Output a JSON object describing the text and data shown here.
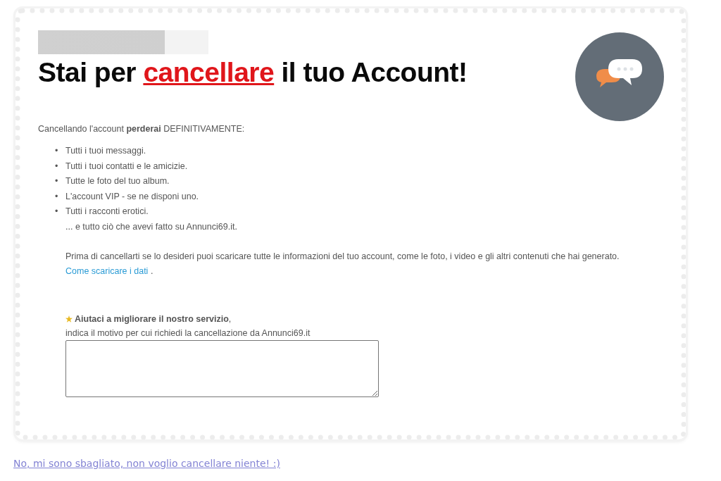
{
  "card": {
    "title": {
      "before": "Stai per ",
      "highlight": "cancellare",
      "after": " il tuo Account!"
    },
    "intro": "Cancellando l'account **perderai** DEFINITIVAMENTE:",
    "losses": [
      {
        "bullet": "•",
        "text": "Tutti i tuoi messaggi."
      },
      {
        "bullet": "•",
        "text": "Tutti i tuoi contatti e le amicizie."
      },
      {
        "bullet": "•",
        "text": "Tutte le foto del tuo album."
      },
      {
        "bullet": "•",
        "text": "L'account VIP - se ne disponi uno."
      },
      {
        "bullet": "•",
        "text": "Tutti i racconti erotici."
      }
    ],
    "losses_tail": "... e tutto ciò che avevi fatto su Annunci69.it.",
    "download_text": "Prima di cancellarti se lo desideri puoi scaricare tutte le informazioni del tuo account, come le foto, i video e gli altri contenuti che hai generato.",
    "download_link": "Come scaricare i dati",
    "download_end": ".",
    "feedback_title": "**Aiutaci a migliorare il nostro servizio**,",
    "feedback_hint": "indica il motivo per cui richiedi la cancellazione da Annunci69.it"
  },
  "cancel_link": "No, mi sono sbagliato, non voglio cancellare niente! :)"
}
